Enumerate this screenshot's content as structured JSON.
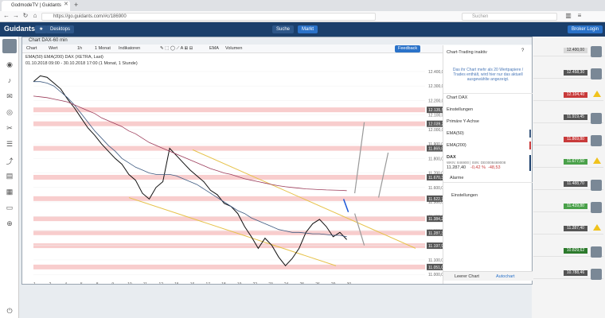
{
  "browser": {
    "tab_title": "GodmodeTV | Guidants",
    "url": "https://go.guidants.com/#c/186900",
    "search_placeholder": "Suchen"
  },
  "app": {
    "logo": "Guidants",
    "desktops_label": "Desktops",
    "search_label": "Suche",
    "markt_label": "Markt",
    "broker_label": "Broker Login"
  },
  "window": {
    "title": "Chart DAX-60 min",
    "toolbar": {
      "chart": "Chart",
      "wert": "Wert",
      "interval": "1h",
      "period": "1 Monat",
      "indicators": "Indikatoren",
      "ema": "EMA",
      "volume": "Volumen",
      "feedback": "Feedback"
    },
    "legend_line1": "EMA(50)   EMA(200)   DAX (XETRA, Last)",
    "legend_line2": "01.10.2018 09:00 - 30.10.2018 17:00   (1 Monat, 1 Stunde)"
  },
  "chart_data": {
    "type": "line",
    "title": "Chart DAX-60 min",
    "y_ticks": [
      12400,
      12300,
      12200,
      12100,
      12000,
      11900,
      11800,
      11700,
      11600,
      11500,
      11400,
      11300,
      11200,
      11100,
      11000
    ],
    "x_ticks": [
      "1",
      "2",
      "4",
      "5",
      "8",
      "9",
      "10",
      "11",
      "12",
      "15",
      "16",
      "17",
      "18",
      "19",
      "22",
      "23",
      "24",
      "25",
      "26",
      "29",
      "30"
    ],
    "ylim": [
      10990,
      12460
    ],
    "price_levels": [
      {
        "label": "12.135,58",
        "value": 12135.58
      },
      {
        "label": "12.039,22",
        "value": 12039.22
      },
      {
        "label": "11.869,80",
        "value": 11869.8
      },
      {
        "label": "11.670,31",
        "value": 11670.31
      },
      {
        "label": "11.522,77",
        "value": 11522.77
      },
      {
        "label": "11.384,21",
        "value": 11384.21
      },
      {
        "label": "11.287,39",
        "value": 11287.39
      },
      {
        "label": "11.197,97",
        "value": 11197.97
      },
      {
        "label": "11.051,04",
        "value": 11051.04
      }
    ],
    "series": [
      {
        "name": "DAX",
        "values": [
          12330,
          12370,
          12360,
          12320,
          12280,
          12210,
          12150,
          12080,
          12010,
          11960,
          11900,
          11850,
          11800,
          11760,
          11690,
          11650,
          11560,
          11520,
          11600,
          11640,
          11870,
          11820,
          11770,
          11720,
          11680,
          11640,
          11580,
          11550,
          11490,
          11470,
          11420,
          11330,
          11260,
          11180,
          11250,
          11200,
          11120,
          11060,
          11110,
          11180,
          11290,
          11350,
          11380,
          11330,
          11260,
          11290,
          11240
        ]
      },
      {
        "name": "EMA(50)",
        "values": [
          12330,
          12330,
          12320,
          12300,
          12260,
          12220,
          12170,
          12110,
          12050,
          11990,
          11940,
          11890,
          11850,
          11800,
          11770,
          11740,
          11720,
          11700,
          11690,
          11690,
          11690,
          11680,
          11660,
          11640,
          11620,
          11590,
          11560,
          11530,
          11500,
          11470,
          11440,
          11420,
          11390,
          11370,
          11350,
          11330,
          11310,
          11300,
          11290,
          11290,
          11285,
          11280,
          11280,
          11275,
          11270,
          11270,
          11260
        ]
      },
      {
        "name": "EMA(200)",
        "values": [
          12230,
          12225,
          12220,
          12210,
          12200,
          12190,
          12170,
          12150,
          12130,
          12110,
          12080,
          12060,
          12040,
          12020,
          11990,
          11970,
          11940,
          11910,
          11890,
          11870,
          11850,
          11830,
          11810,
          11790,
          11770,
          11750,
          11730,
          11715,
          11700,
          11690,
          11675,
          11660,
          11650,
          11640,
          11630,
          11620,
          11612,
          11605,
          11600,
          11595,
          11590,
          11588,
          11585,
          11583,
          11582,
          11580,
          11578
        ]
      }
    ]
  },
  "panel": {
    "trading_label": "Chart-Trading inaktiv",
    "info_text": "Das ihr Chart mehr als 20 Wertpapiere / Trades enthält, wird hier nur das aktuell ausgewählte angezeigt.",
    "chart_title": "Chart DAX",
    "items": [
      "Einstellungen",
      "Primäre Y-Achse",
      "EMA(50)",
      "EMA(200)"
    ],
    "dax_label": "DAX",
    "dax_isin": "WKN: 846900 | ISIN: DE0008469008",
    "dax_price": "11.287,40",
    "dax_change": "-0,42 %",
    "dax_change_abs": "-48,53",
    "alarm_label": "Alarme",
    "settings_label": "Einstellungen",
    "bottom_left": "Leerer Chart",
    "bottom_right": "Autochart"
  },
  "right_column": {
    "tags": [
      "12.400,00",
      "12.458,30",
      "12.104,40",
      "11.919,45",
      "11.869,80",
      "11.677,50",
      "11.488,70",
      "11.439,80",
      "11.287,40",
      "10.829,62",
      "10.788,46"
    ],
    "tag_colors": [
      "#d9d9d9",
      "#555555",
      "#c83a3a",
      "#555555",
      "#c83a3a",
      "#4aa14a",
      "#555555",
      "#4aa14a",
      "#555555",
      "#2c7a2c",
      "#555555"
    ]
  },
  "colors": {
    "header": "#1b3f6b",
    "accent": "#2a72c9",
    "dax_line": "#111111",
    "ema50": "#3d5a80",
    "ema200": "#9c3c5a",
    "resistance_band": "#f5b8b8",
    "trend_channel": "#e6c24a"
  }
}
